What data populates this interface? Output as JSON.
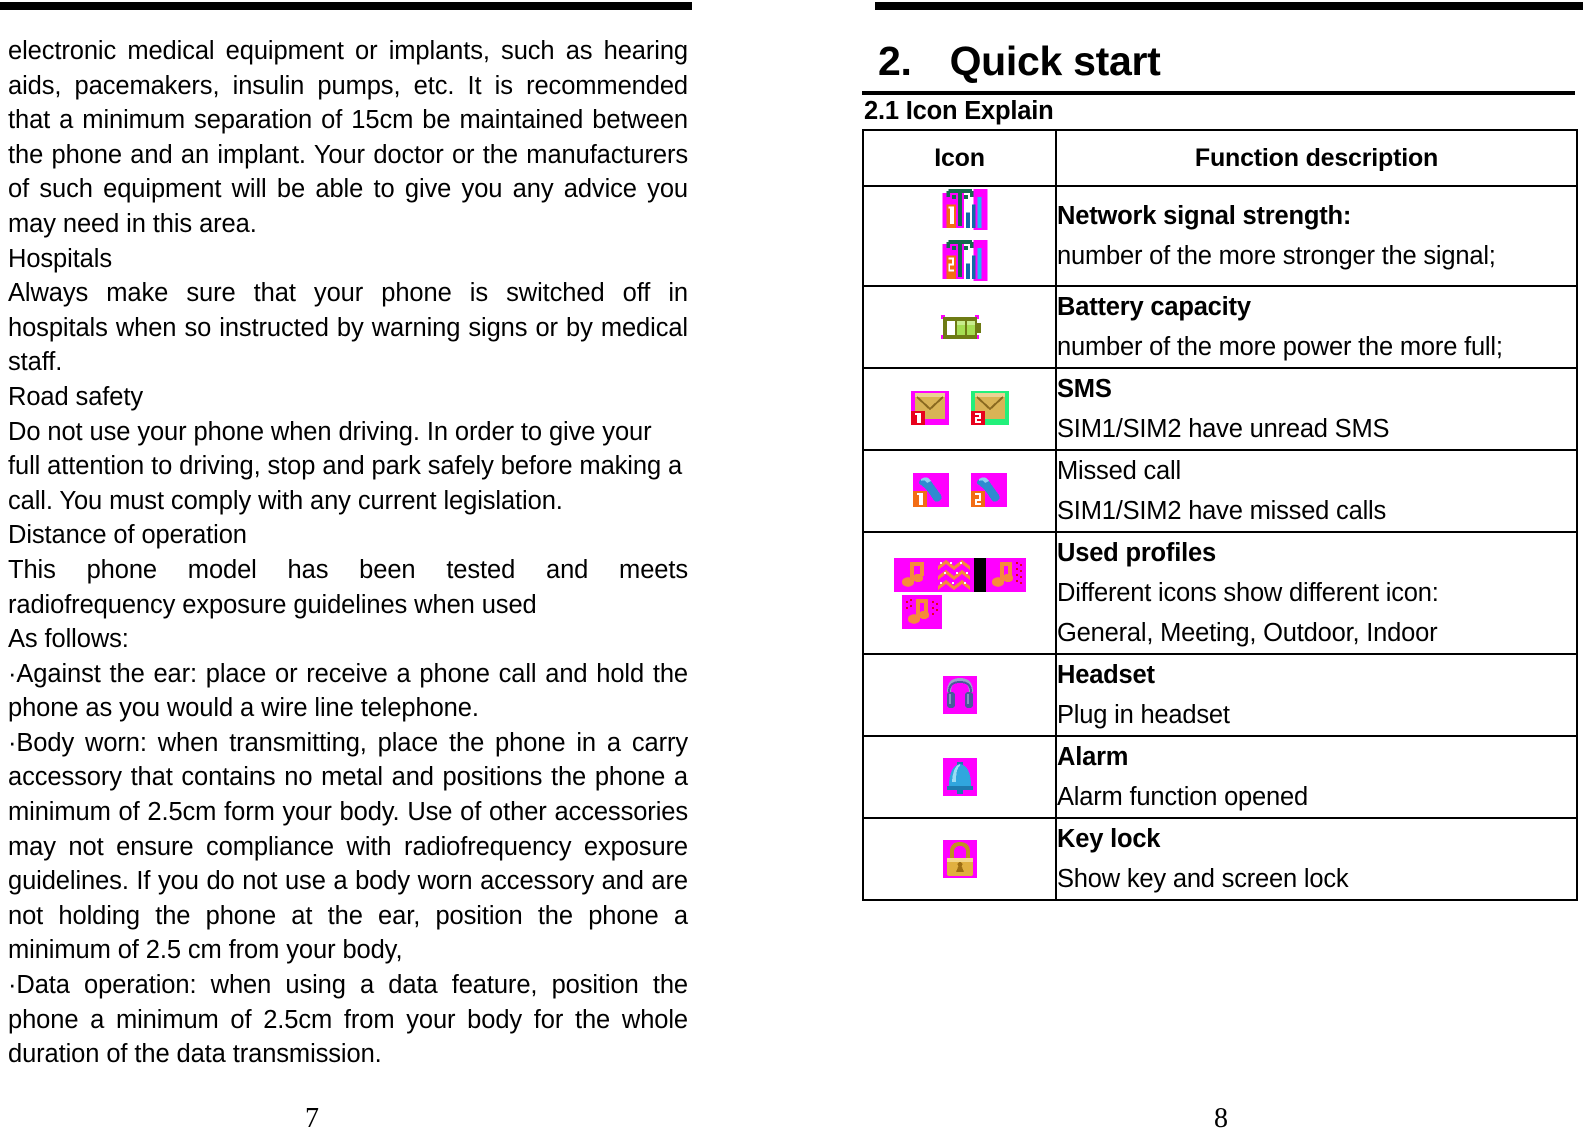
{
  "document": {
    "left_page_number": "7",
    "right_page_number": "8"
  },
  "left_column": {
    "paragraphs": [
      "electronic medical equipment or implants, such as hearing aids, pacemakers, insulin pumps, etc. It is recommended that a minimum separation of 15cm be maintained between the phone and an implant. Your doctor or the manufacturers of such equipment will be able to give you any advice you may need in this area.",
      "Hospitals",
      "Always make sure that your phone is switched off in hospitals when so instructed by warning signs or by medical staff.",
      "Road safety",
      "Do not use your phone when driving. In order to give your full attention to driving, stop and park safely before making a call. You must comply with any current legislation.",
      "Distance of operation",
      "This phone model has been tested and meets radiofrequency exposure guidelines when used",
      "As follows:",
      "·Against the ear: place or receive a phone call and hold the phone as you would a wire line telephone.",
      "·Body worn: when transmitting, place the phone in a carry accessory that contains no metal and positions the phone a minimum of 2.5cm form your body. Use of other accessories may not ensure compliance with radiofrequency exposure guidelines. If you do not use a body worn accessory and are not holding the phone at the ear, position the phone a minimum of 2.5 cm from your body,",
      "·Data operation: when using a data feature, position the phone a minimum of 2.5cm from your body for the whole duration of the data transmission."
    ]
  },
  "right_column": {
    "chapter_number": "2.",
    "chapter_title": "Quick start",
    "section_title": "2.1 Icon Explain",
    "table": {
      "headers": [
        "Icon",
        "Function description"
      ],
      "rows": [
        {
          "icon_names": [
            "signal-strength-sim1-icon",
            "signal-strength-sim2-icon"
          ],
          "title": "Network signal strength:",
          "title_bold": true,
          "description": "number of the more stronger the signal;"
        },
        {
          "icon_names": [
            "battery-capacity-icon"
          ],
          "title": "Battery capacity",
          "title_bold": true,
          "description": "number of the more power the more full;"
        },
        {
          "icon_names": [
            "sms-sim1-icon",
            "sms-sim2-icon"
          ],
          "title": "SMS",
          "title_bold": true,
          "description": "SIM1/SIM2 have unread SMS"
        },
        {
          "icon_names": [
            "missed-call-sim1-icon",
            "missed-call-sim2-icon"
          ],
          "title": "Missed call",
          "title_bold": false,
          "description": "SIM1/SIM2 have missed calls"
        },
        {
          "icon_names": [
            "profile-general-icon",
            "profile-meeting-icon",
            "profile-outdoor-icon",
            "profile-indoor-icon"
          ],
          "title": "Used profiles",
          "title_bold": true,
          "description": "Different icons show different icon:",
          "description2": "General, Meeting, Outdoor, Indoor"
        },
        {
          "icon_names": [
            "headset-icon"
          ],
          "title": "Headset",
          "title_bold": true,
          "description": "Plug in headset"
        },
        {
          "icon_names": [
            "alarm-bell-icon"
          ],
          "title": "Alarm",
          "title_bold": true,
          "description": "Alarm function opened"
        },
        {
          "icon_names": [
            "key-lock-icon"
          ],
          "title": "Key lock",
          "title_bold": true,
          "description": "Show key and screen lock"
        }
      ]
    }
  },
  "colors": {
    "magenta": "#FF00FF",
    "antenna_green": "#126B4C",
    "orange": "#F26C14",
    "bar_cyan": "#22B8F0",
    "bar_blue": "#1168A8",
    "battery_olive": "#6E7B14",
    "battery_green": "#8FD131",
    "envelope_tan": "#D8B356",
    "badge_red": "#E8001C",
    "badge_green": "#22F07A",
    "phone_blue": "#2E8BD0",
    "bell_blue": "#30A6DE",
    "lock_gold": "#E0B040",
    "headset_blue": "#4A5A9B",
    "black": "#000000",
    "white": "#FFFFFF"
  }
}
